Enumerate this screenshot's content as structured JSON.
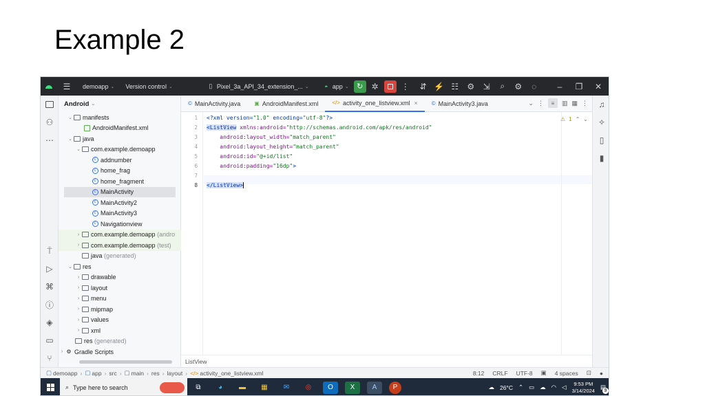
{
  "slide": {
    "title": "Example 2"
  },
  "toolbar": {
    "project_name": "demoapp",
    "version_control": "Version control",
    "device": "Pixel_3a_API_34_extension_...",
    "run_config": "app"
  },
  "project_panel": {
    "view_label": "Android",
    "items": [
      {
        "label": "manifests",
        "extra": ""
      },
      {
        "label": "AndroidManifest.xml",
        "extra": ""
      },
      {
        "label": "java",
        "extra": ""
      },
      {
        "label": "com.example.demoapp",
        "extra": ""
      },
      {
        "label": "addnumber",
        "extra": ""
      },
      {
        "label": "home_frag",
        "extra": ""
      },
      {
        "label": "home_fragment",
        "extra": ""
      },
      {
        "label": "MainActivity",
        "extra": ""
      },
      {
        "label": "MainActivity2",
        "extra": ""
      },
      {
        "label": "MainActivity3",
        "extra": ""
      },
      {
        "label": "Navigationview",
        "extra": ""
      },
      {
        "label": "com.example.demoapp",
        "extra": "(andro"
      },
      {
        "label": "com.example.demoapp",
        "extra": "(test)"
      },
      {
        "label": "java",
        "extra": "(generated)"
      },
      {
        "label": "res",
        "extra": ""
      },
      {
        "label": "drawable",
        "extra": ""
      },
      {
        "label": "layout",
        "extra": ""
      },
      {
        "label": "menu",
        "extra": ""
      },
      {
        "label": "mipmap",
        "extra": ""
      },
      {
        "label": "values",
        "extra": ""
      },
      {
        "label": "xml",
        "extra": ""
      },
      {
        "label": "res",
        "extra": "(generated)"
      },
      {
        "label": "Gradle Scripts",
        "extra": ""
      }
    ]
  },
  "tabs": [
    {
      "label": "MainActivity.java"
    },
    {
      "label": "AndroidManifest.xml"
    },
    {
      "label": "activity_one_listview.xml"
    },
    {
      "label": "MainActivity3.java"
    }
  ],
  "editor": {
    "line_numbers": [
      "1",
      "2",
      "3",
      "4",
      "5",
      "6",
      "7",
      "8"
    ],
    "lines": {
      "l1_a": "<?xml version=",
      "l1_b": "\"1.0\"",
      "l1_c": " encoding=",
      "l1_d": "\"utf-8\"",
      "l1_e": "?>",
      "l2_a": "<ListView",
      "l2_b": " xmlns:android=",
      "l2_c": "\"http://schemas.android.com/apk/res/android\"",
      "l3_a": "    android:layout_width=",
      "l3_b": "\"match_parent\"",
      "l4_a": "    android:layout_height=",
      "l4_b": "\"match_parent\"",
      "l5_a": "    android:id=",
      "l5_b": "\"@+id/list\"",
      "l6_a": "    android:padding=",
      "l6_b": "\"16dp\"",
      "l6_c": ">",
      "l8_a": "</ListView",
      "l8_b": ">"
    },
    "warning_count": "1",
    "breadcrumb": "ListView"
  },
  "statusbar": {
    "crumbs": [
      "demoapp",
      "app",
      "src",
      "main",
      "res",
      "layout",
      "activity_one_listview.xml"
    ],
    "position": "8:12",
    "line_sep": "CRLF",
    "encoding": "UTF-8",
    "indent": "4 spaces"
  },
  "taskbar": {
    "search_placeholder": "Type here to search",
    "temperature": "26°C",
    "time": "9:53 PM",
    "date": "3/14/2024",
    "notification_count": "9"
  },
  "colors": {
    "toolbar_bg": "#27282c",
    "accent": "#3574f0",
    "run": "#3c9a4c",
    "stop": "#d8453f",
    "taskbar_bg": "#1f2b3b"
  }
}
